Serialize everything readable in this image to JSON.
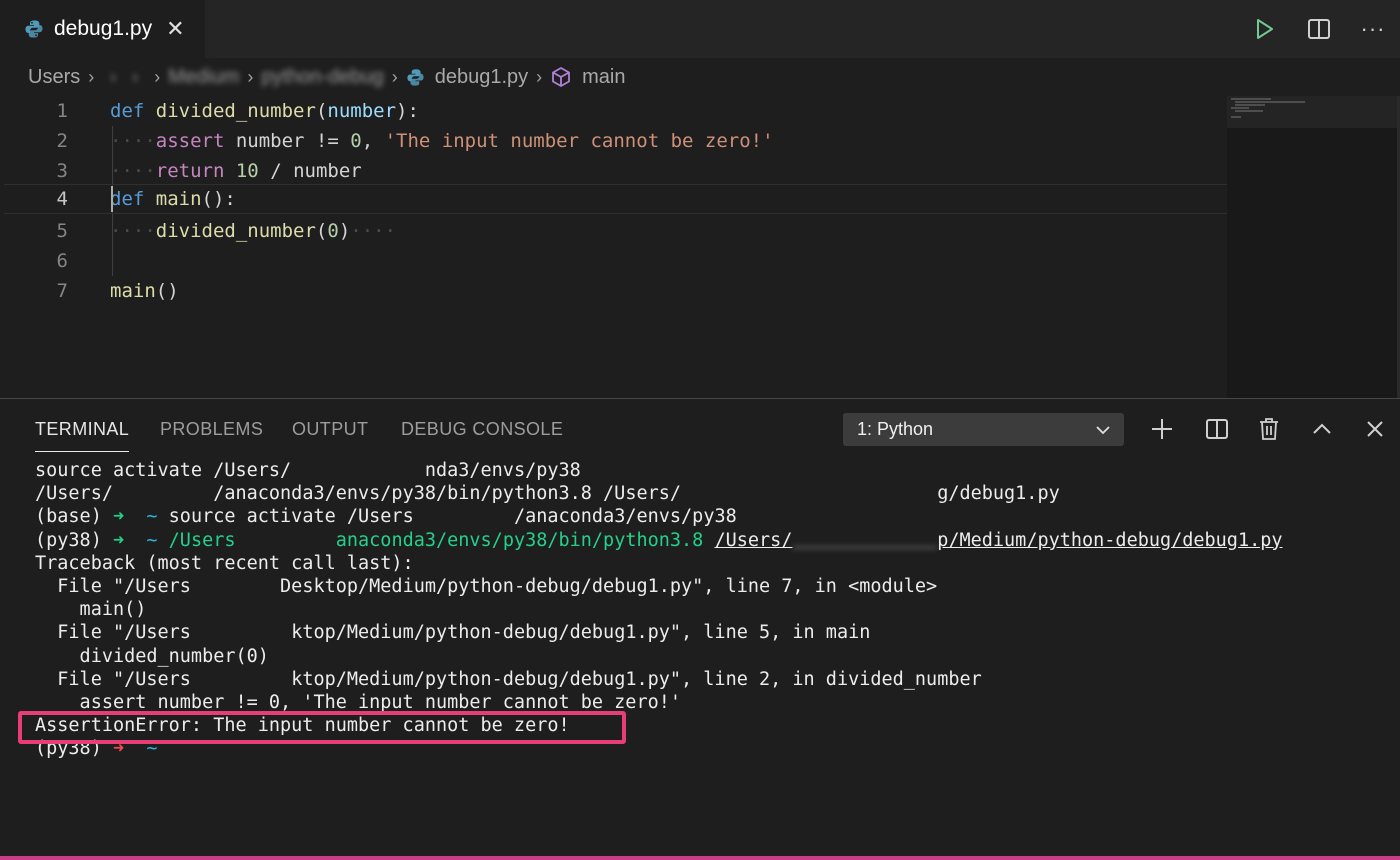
{
  "tab": {
    "label": "debug1.py",
    "close_glyph": "✕"
  },
  "toolbar": {
    "run": "run-icon",
    "split": "split-editor-icon",
    "more": "···"
  },
  "breadcrumbs": {
    "items": [
      "Users",
      "",
      "",
      "",
      "Medium",
      "python-debug",
      "debug1.py",
      "main"
    ],
    "separator": "›"
  },
  "editor": {
    "lines": [
      {
        "n": "1"
      },
      {
        "n": "2"
      },
      {
        "n": "3"
      },
      {
        "n": "4"
      },
      {
        "n": "5"
      },
      {
        "n": "6"
      },
      {
        "n": "7"
      }
    ],
    "tokens": {
      "l1_def": "def",
      "l1_fn": "divided_number",
      "l1_open": "(",
      "l1_param": "number",
      "l1_close": "):",
      "l2_ws": "····",
      "l2_kw": "assert",
      "l2_mid": " number != ",
      "l2_num": "0",
      "l2_comma": ", ",
      "l2_str": "'The input number cannot be zero!'",
      "l3_ws": "····",
      "l3_kw": "return",
      "l3_num": "10",
      "l3_rest": " / number",
      "l4_def": "def",
      "l4_fn": "main",
      "l4_rest": "():",
      "l5_ws": "····",
      "l5_fn": "divided_number",
      "l5_open": "(",
      "l5_num": "0",
      "l5_close": ")",
      "l5_trail": "····",
      "l7_fn": "main",
      "l7_rest": "()"
    }
  },
  "panel": {
    "tabs": [
      "TERMINAL",
      "PROBLEMS",
      "OUTPUT",
      "DEBUG CONSOLE"
    ],
    "terminal_select": "1: Python",
    "actions": [
      "add-terminal-icon",
      "split-terminal-icon",
      "trash-icon",
      "maximize-panel-icon",
      "close-panel-icon"
    ]
  },
  "terminal": {
    "l1a": "source activate /Users/",
    "l1b": "            ",
    "l1c": "nda3/envs/py38",
    "l2a": "/Users/",
    "l2b": "         ",
    "l2c": "/anaconda3/envs/py38/bin/python3.8 /Users/",
    "l2d": "                       ",
    "l2e": "g/debug1.py",
    "l3a": "(base) ",
    "l3arrow": "➜",
    "l3b": "  ",
    "l3tilde": "~",
    "l3c": " source activate /Users",
    "l3d": "         ",
    "l3e": "/anaconda3/envs/py38",
    "l4a": "(py38) ",
    "l4arrow": "➜",
    "l4b": "  ",
    "l4tilde": "~",
    "l4c": " /Users",
    "l4d": "         ",
    "l4e": "anaconda3/envs/py38/bin/python3.8",
    "l4f": " ",
    "l4g": "/Users/",
    "l4h": "             ",
    "l4i": "p/Medium/python-debug/debug1.py",
    "l5": "Traceback (most recent call last):",
    "l6a": "  File \"/Users",
    "l6b": "        ",
    "l6c": "Desktop/Medium/python-debug/debug1.py\", line 7, in <module>",
    "l7": "    main()",
    "l8a": "  File \"/Users",
    "l8b": "         ",
    "l8c": "ktop/Medium/python-debug/debug1.py\", line 5, in main",
    "l9": "    divided_number(0)",
    "l10a": "  File \"/Users",
    "l10b": "         ",
    "l10c": "ktop/Medium/python-debug/debug1.py\", line 2, in divided_number",
    "l11": "    assert number != 0, 'The input number cannot be zero!'",
    "l12": "AssertionError: The input number cannot be zero!",
    "l13a": "(py38) ",
    "l13arrow": "➜",
    "l13b": "  ",
    "l13tilde": "~"
  },
  "colors": {
    "accent_box": "#e83e76",
    "green": "#23d18b",
    "cyan": "#29b8db",
    "red": "#f14c4c"
  }
}
